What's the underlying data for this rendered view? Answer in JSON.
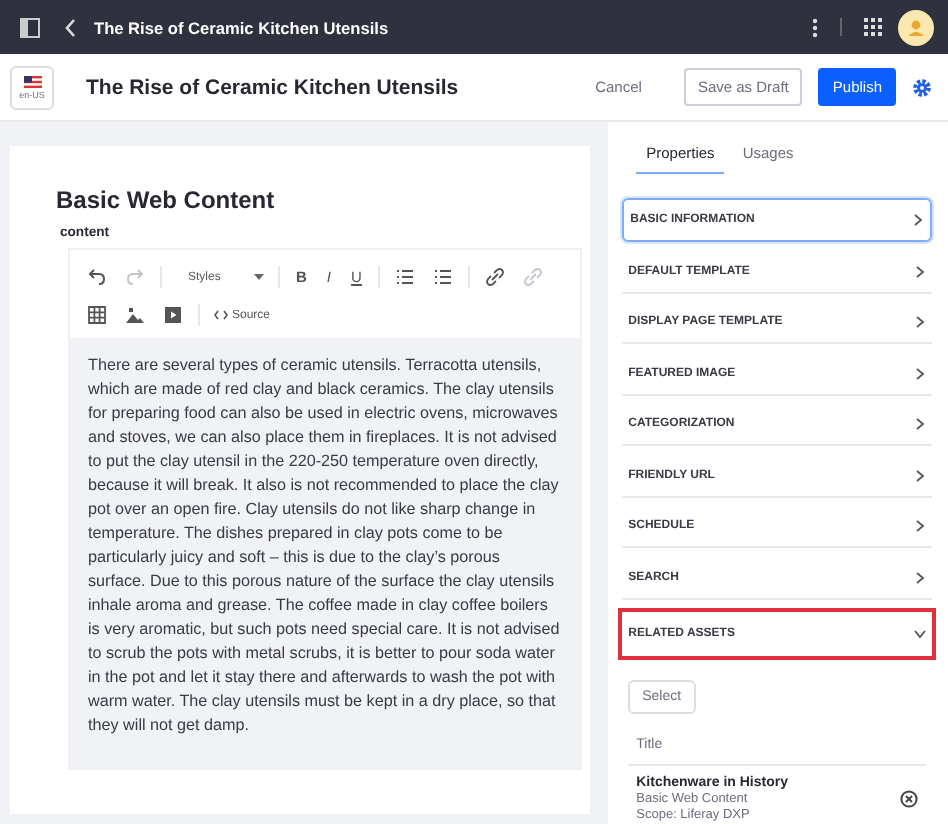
{
  "top_bar": {
    "title": "The Rise of Ceramic Kitchen Utensils"
  },
  "header": {
    "locale": "en-US",
    "title": "The Rise of Ceramic Kitchen Utensils",
    "buttons": [
      {
        "kind": "text",
        "label": "Cancel"
      },
      {
        "kind": "secondary",
        "label": "Save as Draft"
      },
      {
        "kind": "primary",
        "label": "Publish"
      }
    ]
  },
  "editor": {
    "heading": "Basic Web Content",
    "field_label": "content",
    "toolbar_rows": [
      [
        {
          "kind": "undo",
          "disabled": false
        },
        {
          "kind": "redo",
          "disabled": true
        },
        {
          "kind": "styles",
          "label": "Styles",
          "disabled": false
        },
        {
          "kind": "bold",
          "label": "B",
          "disabled": false
        },
        {
          "kind": "italic",
          "label": "I",
          "disabled": false
        },
        {
          "kind": "underline",
          "label": "U",
          "disabled": false
        },
        {
          "kind": "ordered-list",
          "disabled": false
        },
        {
          "kind": "bullet-list",
          "disabled": false
        },
        {
          "kind": "link",
          "disabled": false
        },
        {
          "kind": "unlink",
          "disabled": true
        }
      ],
      [
        {
          "kind": "table",
          "disabled": false
        },
        {
          "kind": "image",
          "disabled": false
        },
        {
          "kind": "video",
          "disabled": false
        },
        {
          "kind": "source",
          "label": "Source",
          "disabled": false
        }
      ]
    ],
    "body": "There are several types of ceramic utensils. Terracotta utensils, which are made of red clay and black ceramics. The clay utensils for preparing food can also be used in electric ovens, microwaves and stoves, we can also place them in fireplaces. It is not advised to put the clay utensil in the 220-250 temperature oven directly, because it will break. It also is not recommended to place the clay pot over an open fire. Clay utensils do not like sharp change in temperature. The dishes prepared in clay pots come to be particularly juicy and soft – this is due to the clay’s porous surface. Due to this porous nature of the surface the clay utensils inhale aroma and grease. The coffee made in clay coffee boilers is very aromatic, but such pots need special care. It is not advised to scrub the pots with metal scrubs, it is better to pour soda water in the pot and let it stay there and afterwards to wash the pot with warm water. The clay utensils must be kept in a dry place, so that they will not get damp."
  },
  "sidebar": {
    "tabs": [
      {
        "label": "Properties",
        "selected": true
      },
      {
        "label": "Usages",
        "selected": false
      }
    ],
    "sections": [
      {
        "label": "BASIC INFORMATION",
        "expanded": false,
        "focused": true,
        "highlighted": false
      },
      {
        "label": "DEFAULT TEMPLATE",
        "expanded": false,
        "focused": false,
        "highlighted": false
      },
      {
        "label": "DISPLAY PAGE TEMPLATE",
        "expanded": false,
        "focused": false,
        "highlighted": false
      },
      {
        "label": "FEATURED IMAGE",
        "expanded": false,
        "focused": false,
        "highlighted": false
      },
      {
        "label": "CATEGORIZATION",
        "expanded": false,
        "focused": false,
        "highlighted": false
      },
      {
        "label": "FRIENDLY URL",
        "expanded": false,
        "focused": false,
        "highlighted": false
      },
      {
        "label": "SCHEDULE",
        "expanded": false,
        "focused": false,
        "highlighted": false
      },
      {
        "label": "SEARCH",
        "expanded": false,
        "focused": false,
        "highlighted": false
      },
      {
        "label": "RELATED ASSETS",
        "expanded": true,
        "focused": false,
        "highlighted": true
      }
    ],
    "related_assets": {
      "select_button": "Select",
      "column": "Title",
      "rows": [
        {
          "title": "Kitchenware in History",
          "type": "Basic Web Content",
          "scope": "Scope: Liferay DXP"
        }
      ]
    }
  }
}
